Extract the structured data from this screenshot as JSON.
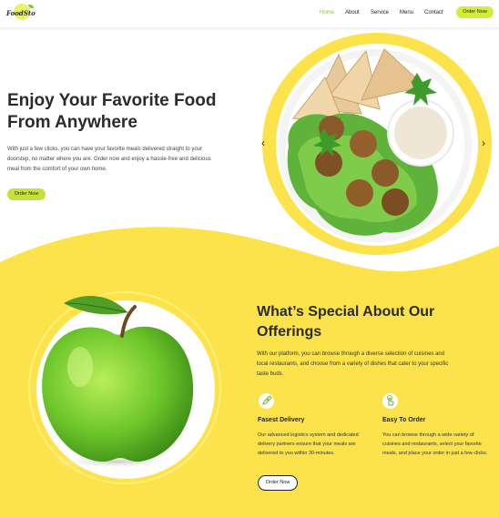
{
  "brand": {
    "logo_text": "FoodSto"
  },
  "nav": {
    "links": [
      "Home",
      "About",
      "Service",
      "Menu",
      "Contact"
    ],
    "cta": "Order Now"
  },
  "hero": {
    "title": "Enjoy Your Favorite Food From Anywhere",
    "description": "With just a few clicks, you can have your favorite meals delivered straight to your doorstep, no matter where you are. Order now and enjoy a hassle-free and delicious meal from the comfort of your own home.",
    "cta": "Order Now",
    "prev_arrow": "‹",
    "next_arrow": "›"
  },
  "offerings": {
    "title": "What’s Special About Our Offerings",
    "description": "With our platform, you can browse through a diverse selection of cuisines and local restaurants, and choose from a variety of dishes that cater to your specific taste buds.",
    "features": [
      {
        "title": "Fasest Delivery",
        "icon": "rocket-icon",
        "description": "Our advanced logistics system and dedicated delivery partners ensure that your meals are delivered to you within 30-minutes."
      },
      {
        "title": "Easy To Order",
        "icon": "tap-hand-icon",
        "description": "You can browse through a wide variety of cuisines and restaurants, select your favorite meals, and place your order in just a few clicks."
      }
    ],
    "cta": "Order Now"
  },
  "colors": {
    "accent": "#d4ec3a",
    "yellow": "#fde34b",
    "home_link": "#8bc34a"
  }
}
